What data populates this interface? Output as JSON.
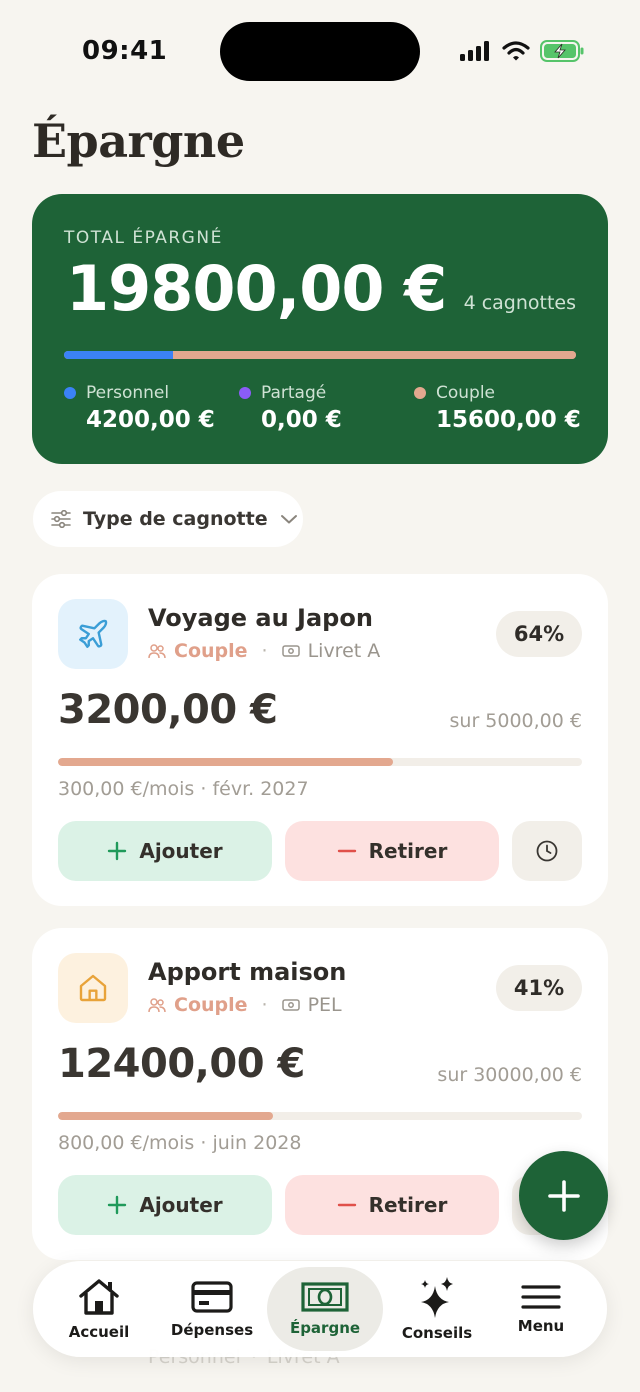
{
  "status": {
    "time": "09:41"
  },
  "page": {
    "title": "Épargne"
  },
  "summary": {
    "label": "TOTAL ÉPARGNÉ",
    "amount": "19800,00 €",
    "count": "4 cagnottes",
    "split_fractions": {
      "personnel": 0.212,
      "partage": 0.0,
      "couple": 0.788
    },
    "legend": [
      {
        "label": "Personnel",
        "value": "4200,00 €",
        "color": "#3b82f6"
      },
      {
        "label": "Partagé",
        "value": "0,00 €",
        "color": "#8b5cf6"
      },
      {
        "label": "Couple",
        "value": "15600,00 €",
        "color": "#e3a88f"
      }
    ]
  },
  "filter": {
    "label": "Type de cagnotte"
  },
  "goals": [
    {
      "name": "Voyage au Japon",
      "icon": "airplane-icon",
      "icon_bg": "#e3f2fc",
      "icon_color": "#3b9ed6",
      "owner": "Couple",
      "account": "Livret A",
      "percent_label": "64%",
      "progress": 0.64,
      "amount": "3200,00 €",
      "target": "sur 5000,00 €",
      "monthly": "300,00 €/mois · févr. 2027",
      "add_label": "Ajouter",
      "withdraw_label": "Retirer"
    },
    {
      "name": "Apport maison",
      "icon": "house-icon",
      "icon_bg": "#fdf1df",
      "icon_color": "#e8a33a",
      "owner": "Couple",
      "account": "PEL",
      "percent_label": "41%",
      "progress": 0.41,
      "amount": "12400,00 €",
      "target": "sur 30000,00 €",
      "monthly": "800,00 €/mois · juin 2028",
      "add_label": "Ajouter",
      "withdraw_label": "Retirer"
    }
  ],
  "ghost": {
    "owner": "Personnel",
    "account": "Livret A"
  },
  "tabs": [
    {
      "label": "Accueil",
      "icon": "home-icon"
    },
    {
      "label": "Dépenses",
      "icon": "card-icon"
    },
    {
      "label": "Épargne",
      "icon": "banknote-icon",
      "active": true
    },
    {
      "label": "Conseils",
      "icon": "sparkles-icon"
    },
    {
      "label": "Menu",
      "icon": "menu-icon"
    }
  ],
  "colors": {
    "brand_green": "#1e6337",
    "couple": "#e3a88f",
    "background": "#f7f5f0"
  }
}
